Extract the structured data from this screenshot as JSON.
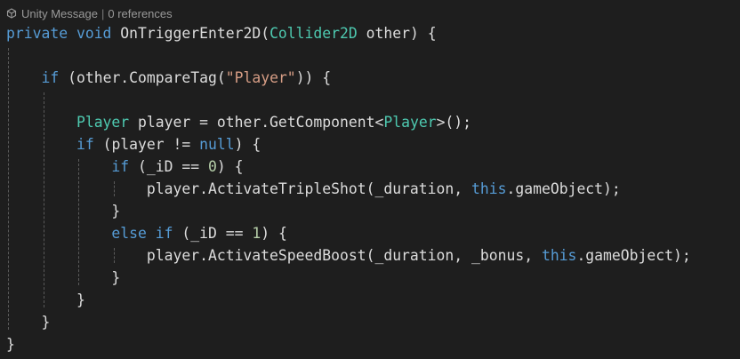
{
  "codelens": {
    "icon": "unity-cube-icon",
    "unity_message": "Unity Message",
    "separator": "|",
    "references": "0 references"
  },
  "colors": {
    "background": "#1e1e1e",
    "keyword": "#569cd6",
    "type": "#4ec9b0",
    "string": "#d69d85",
    "number": "#b5cea8",
    "text": "#dcdcdc",
    "codelens": "#999999",
    "guide": "#5a5a5a"
  },
  "code": {
    "lines": [
      [
        {
          "t": "private",
          "c": "kw"
        },
        {
          "t": " ",
          "c": "tx"
        },
        {
          "t": "void",
          "c": "kw"
        },
        {
          "t": " OnTriggerEnter2D(",
          "c": "tx"
        },
        {
          "t": "Collider2D",
          "c": "ty"
        },
        {
          "t": " other) {",
          "c": "tx"
        }
      ],
      [],
      [
        {
          "t": "    ",
          "c": "tx"
        },
        {
          "t": "if",
          "c": "kw"
        },
        {
          "t": " (other.CompareTag(",
          "c": "tx"
        },
        {
          "t": "\"Player\"",
          "c": "st"
        },
        {
          "t": ")) {",
          "c": "tx"
        }
      ],
      [],
      [
        {
          "t": "        ",
          "c": "tx"
        },
        {
          "t": "Player",
          "c": "ty"
        },
        {
          "t": " player = other.GetComponent<",
          "c": "tx"
        },
        {
          "t": "Player",
          "c": "ty"
        },
        {
          "t": ">();",
          "c": "tx"
        }
      ],
      [
        {
          "t": "        ",
          "c": "tx"
        },
        {
          "t": "if",
          "c": "kw"
        },
        {
          "t": " (player != ",
          "c": "tx"
        },
        {
          "t": "null",
          "c": "kw"
        },
        {
          "t": ") {",
          "c": "tx"
        }
      ],
      [
        {
          "t": "            ",
          "c": "tx"
        },
        {
          "t": "if",
          "c": "kw"
        },
        {
          "t": " (_iD == ",
          "c": "tx"
        },
        {
          "t": "0",
          "c": "nu"
        },
        {
          "t": ") {",
          "c": "tx"
        }
      ],
      [
        {
          "t": "                player.ActivateTripleShot(_duration, ",
          "c": "tx"
        },
        {
          "t": "this",
          "c": "kw"
        },
        {
          "t": ".gameObject);",
          "c": "tx"
        }
      ],
      [
        {
          "t": "            }",
          "c": "tx"
        }
      ],
      [
        {
          "t": "            ",
          "c": "tx"
        },
        {
          "t": "else",
          "c": "kw"
        },
        {
          "t": " ",
          "c": "tx"
        },
        {
          "t": "if",
          "c": "kw"
        },
        {
          "t": " (_iD == ",
          "c": "tx"
        },
        {
          "t": "1",
          "c": "nu"
        },
        {
          "t": ") {",
          "c": "tx"
        }
      ],
      [
        {
          "t": "                player.ActivateSpeedBoost(_duration, _bonus, ",
          "c": "tx"
        },
        {
          "t": "this",
          "c": "kw"
        },
        {
          "t": ".gameObject);",
          "c": "tx"
        }
      ],
      [
        {
          "t": "            }",
          "c": "tx"
        }
      ],
      [
        {
          "t": "        }",
          "c": "tx"
        }
      ],
      [
        {
          "t": "    }",
          "c": "tx"
        }
      ],
      [
        {
          "t": "}",
          "c": "tx"
        }
      ]
    ]
  }
}
